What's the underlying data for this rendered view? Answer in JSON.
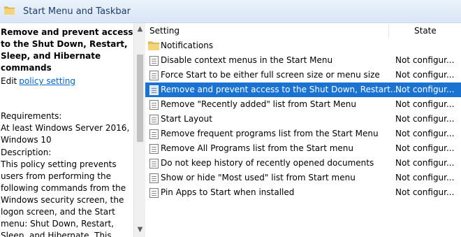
{
  "header": {
    "title": "Start Menu and Taskbar",
    "icon": "folder-icon"
  },
  "left_pane": {
    "policy_title": "Remove and prevent access to the Shut Down, Restart, Sleep, and Hibernate commands",
    "edit_prefix": "Edit",
    "edit_link": "policy setting",
    "requirements_label": "Requirements:",
    "requirements_text": "At least Windows Server 2016, Windows 10",
    "description_label": "Description:",
    "description_text": "This policy setting prevents users from performing the following commands from the Windows security screen, the logon screen, and the Start menu: Shut Down, Restart, Sleep, and Hibernate. This"
  },
  "list": {
    "columns": {
      "setting": "Setting",
      "state": "State"
    },
    "folder_row": {
      "name": "Notifications",
      "icon": "folder-icon"
    },
    "rows": [
      {
        "name": "Disable context menus in the Start Menu",
        "state": "Not configur...",
        "icon": "policy-doc-icon"
      },
      {
        "name": "Force Start to be either full screen size or menu size",
        "state": "Not configur...",
        "icon": "policy-doc-icon"
      },
      {
        "name": "Remove and prevent access to the Shut Down, Restart...",
        "state": "Not configur...",
        "icon": "policy-doc-icon",
        "selected": true
      },
      {
        "name": "Remove \"Recently added\" list from Start Menu",
        "state": "Not configur...",
        "icon": "policy-doc-icon"
      },
      {
        "name": "Start Layout",
        "state": "Not configur...",
        "icon": "policy-doc-icon"
      },
      {
        "name": "Remove frequent programs list from the Start Menu",
        "state": "Not configur...",
        "icon": "policy-doc-icon"
      },
      {
        "name": "Remove All Programs list from the Start menu",
        "state": "Not configur...",
        "icon": "policy-doc-icon"
      },
      {
        "name": "Do not keep history of recently opened documents",
        "state": "Not configur...",
        "icon": "policy-doc-icon"
      },
      {
        "name": "Show or hide \"Most used\" list from Start menu",
        "state": "Not configur...",
        "icon": "policy-doc-icon"
      },
      {
        "name": "Pin Apps to Start when installed",
        "state": "Not configur...",
        "icon": "policy-doc-icon"
      }
    ]
  },
  "colors": {
    "selection": "#1a73d1",
    "link": "#0066cc",
    "header_text": "#1e3b6c"
  }
}
